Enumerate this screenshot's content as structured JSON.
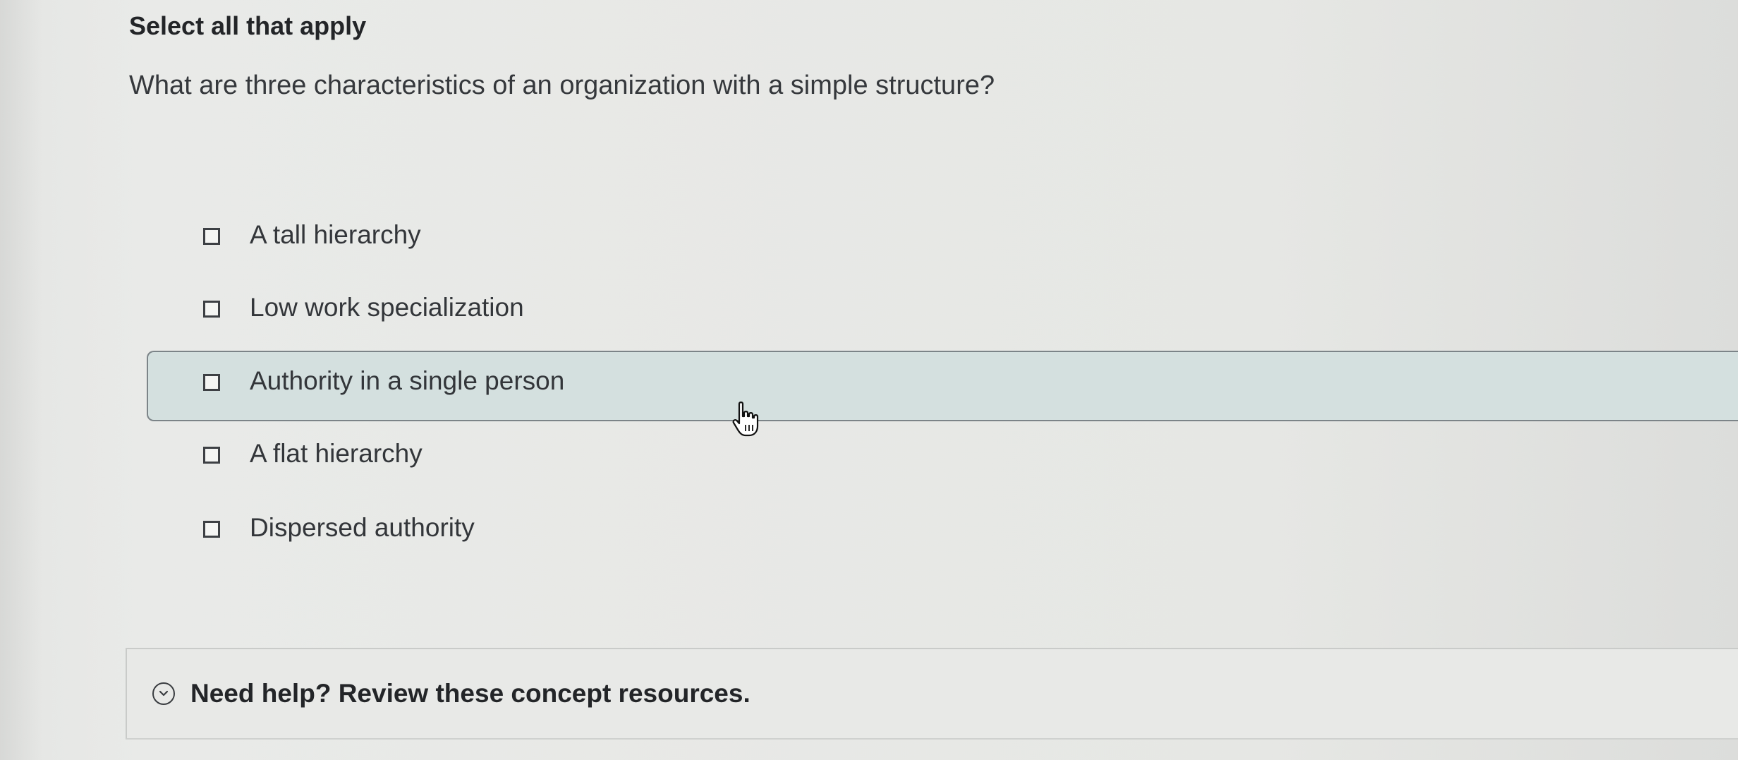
{
  "instruction": "Select all that apply",
  "question": "What are three characteristics of an organization with a simple structure?",
  "options": [
    {
      "label": "A tall hierarchy",
      "checked": false
    },
    {
      "label": "Low work specialization",
      "checked": false
    },
    {
      "label": "Authority in a single person",
      "checked": false
    },
    {
      "label": "A flat hierarchy",
      "checked": false
    },
    {
      "label": "Dispersed authority",
      "checked": false
    }
  ],
  "help": {
    "label": "Need help? Review these concept resources.",
    "icon": "chevron-down-circle-icon"
  },
  "colors": {
    "hover_background": "#d4e0df",
    "text": "#33363a",
    "background": "#e8e9e7"
  }
}
